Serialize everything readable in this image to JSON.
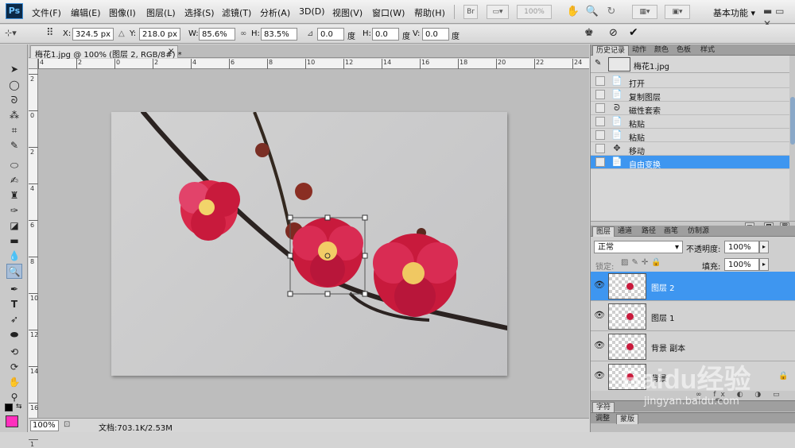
{
  "app": {
    "logo_text": "Ps"
  },
  "menu": [
    "文件(F)",
    "编辑(E)",
    "图像(I)",
    "图层(L)",
    "选择(S)",
    "滤镜(T)",
    "分析(A)",
    "3D(D)",
    "视图(V)",
    "窗口(W)",
    "帮助(H)"
  ],
  "menubar_extras": {
    "br_label": "Br",
    "zoom_value": "100%",
    "workspace": "基本功能"
  },
  "options": {
    "x_label": "X:",
    "x_value": "324.5 px",
    "y_label": "Y:",
    "y_value": "218.0 px",
    "w_label": "W:",
    "w_value": "85.6%",
    "h_label": "H:",
    "h_value": "83.5%",
    "angle_value": "0.0",
    "angle_unit": "度",
    "hskew_label": "H:",
    "hskew_value": "0.0",
    "hskew_unit": "度",
    "vskew_label": "V:",
    "vskew_value": "0.0",
    "vskew_unit": "度"
  },
  "document": {
    "tab_title": "梅花1.jpg @ 100% (图层 2, RGB/8#) *",
    "close": "×"
  },
  "rulers": {
    "h_ticks": [
      "4",
      "2",
      "0",
      "2",
      "4",
      "6",
      "8",
      "10",
      "12",
      "14",
      "16",
      "18",
      "20",
      "22",
      "24"
    ],
    "v_ticks": [
      "2",
      "0",
      "2",
      "4",
      "6",
      "8",
      "10",
      "12",
      "14",
      "16",
      "1"
    ]
  },
  "status": {
    "zoom": "100%",
    "doc_size": "文档:703.1K/2.53M"
  },
  "history": {
    "tabs": [
      "历史记录",
      "动作",
      "颜色",
      "色板",
      "样式"
    ],
    "snapshot": "梅花1.jpg",
    "items": [
      "打开",
      "复制图层",
      "磁性套索",
      "粘贴",
      "粘贴",
      "移动",
      "自由变换"
    ],
    "selected_index": 6
  },
  "layers": {
    "tabs": [
      "图层",
      "通道",
      "路径",
      "画笔",
      "仿制源"
    ],
    "blend_mode": "正常",
    "opacity_label": "不透明度:",
    "opacity_value": "100%",
    "lock_label": "锁定:",
    "fill_label": "填充:",
    "fill_value": "100%",
    "items": [
      "图层 2",
      "图层 1",
      "背景 副本",
      "背景"
    ],
    "selected_index": 0
  },
  "bottom_tabs": {
    "row1": [
      "字符"
    ],
    "row2": [
      "调整",
      "蒙版"
    ]
  },
  "watermark": {
    "logo": "Baidu经验",
    "url": "jingyan.baidu.com"
  },
  "colors": {
    "accent": "#3e96f0",
    "foreground_swatch": "#ff2fbd",
    "petal": "#c81a3c",
    "branch": "#2b2321"
  }
}
